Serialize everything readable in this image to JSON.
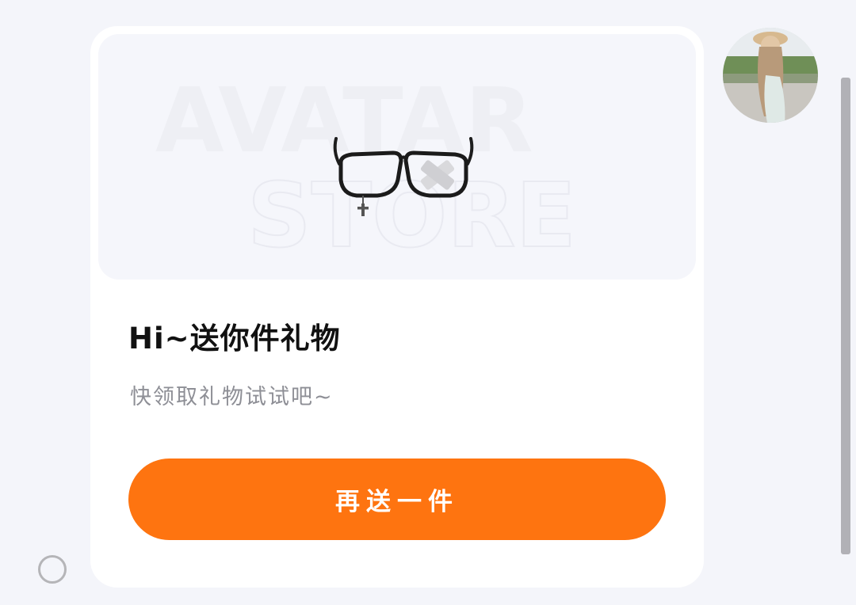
{
  "gift_card": {
    "banner": {
      "watermark_line1": "AVATAR",
      "watermark_line2": "STORE",
      "item_icon": "glasses-with-cross-pendant"
    },
    "title": "Hi~送你件礼物",
    "subtitle": "快领取礼物试试吧~",
    "send_again_label": "再送一件"
  },
  "avatar": {
    "icon": "user-avatar-photo"
  },
  "colors": {
    "page_background": "#f4f5fa",
    "card_background": "#ffffff",
    "banner_background": "#f5f6fb",
    "accent": "#fe7410",
    "title_text": "#111111",
    "subtitle_text": "#8e8f96"
  }
}
